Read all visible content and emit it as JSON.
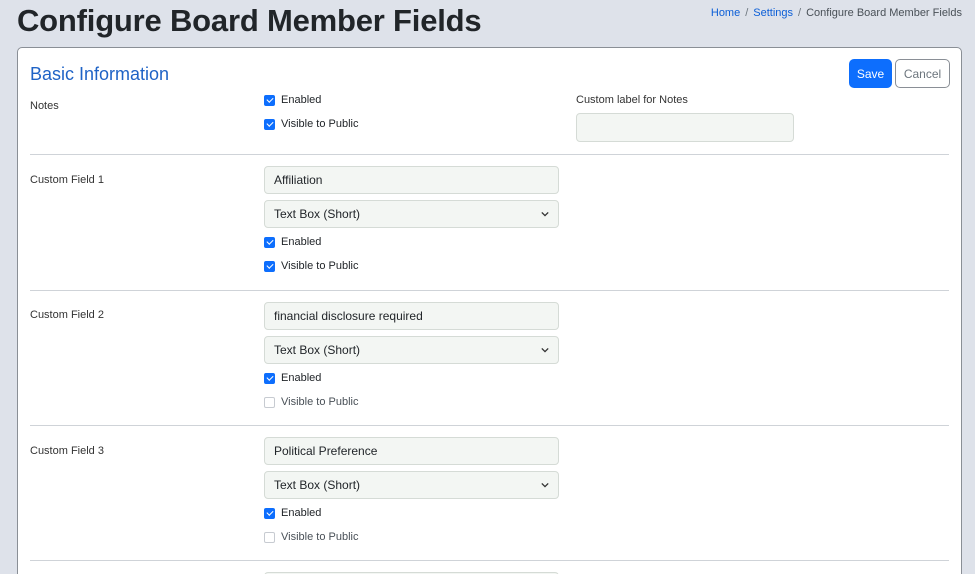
{
  "page": {
    "title": "Configure Board Member Fields"
  },
  "breadcrumb": {
    "home": "Home",
    "settings": "Settings",
    "current": "Configure Board Member Fields",
    "separator": "/"
  },
  "card": {
    "title": "Basic Information",
    "save_label": "Save",
    "cancel_label": "Cancel"
  },
  "notes": {
    "label": "Notes",
    "enabled_label": "Enabled",
    "enabled": true,
    "visible_label": "Visible to Public",
    "visible": true,
    "custom_label": "Custom label for Notes",
    "custom_value": ""
  },
  "custom_fields": [
    {
      "label": "Custom Field 1",
      "name_value": "Affiliation",
      "type_value": "Text Box (Short)",
      "enabled_label": "Enabled",
      "enabled": true,
      "visible_label": "Visible to Public",
      "visible": true
    },
    {
      "label": "Custom Field 2",
      "name_value": "financial disclosure required",
      "type_value": "Text Box (Short)",
      "enabled_label": "Enabled",
      "enabled": true,
      "visible_label": "Visible to Public",
      "visible": false
    },
    {
      "label": "Custom Field 3",
      "name_value": "Political Preference",
      "type_value": "Text Box (Short)",
      "enabled_label": "Enabled",
      "enabled": true,
      "visible_label": "Visible to Public",
      "visible": false
    }
  ],
  "colors": {
    "accent": "#0d6efd",
    "title_blue": "#1f63c6",
    "background": "#dee2ea",
    "input_bg": "#f3f6f3"
  }
}
